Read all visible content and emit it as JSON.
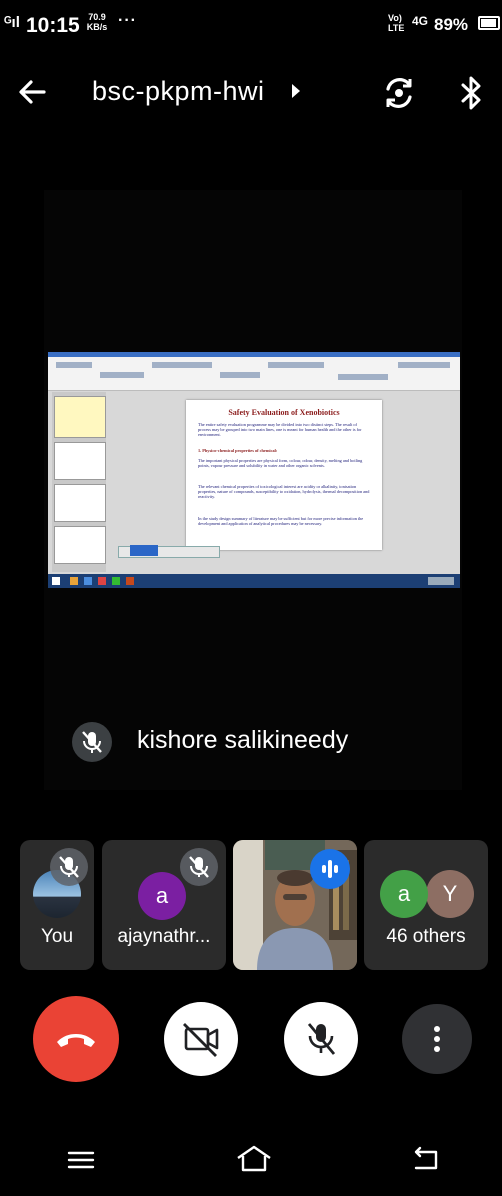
{
  "status_bar": {
    "signal": "ᴳıl",
    "time": "10:15",
    "speed_value": "70.9",
    "speed_unit": "KB/s",
    "overflow": "···",
    "network_top": "Vo)",
    "network_bottom": "LTE",
    "network_type": "4G",
    "battery": "89%"
  },
  "header": {
    "meeting_code": "bsc-pkpm-hwi"
  },
  "main_tile": {
    "presenter_name": "kishore salikineedy",
    "slide": {
      "title": "Safety Evaluation of Xenobiotics",
      "bullets": [
        "The entire safety evaluation programme may be divided into two distinct steps. The result of process may be grouped into two main lines, one is meant for human health and the other is for environment.",
        "1. Physico-chemical properties of chemical:",
        "The important physical properties are physical form, colour, odour, density, melting and boiling points, vapour pressure and solubility in water and other organic solvents.",
        "The relevant chemical properties of toxicological interest are acidity or alkalinity, ionisation properties, nature of compounds, susceptibility to oxidation, hydrolysis, thermal decomposition and reactivity.",
        "In the study design summary of literature may be sufficient but for more precise information the development and application of analytical procedures may be necessary."
      ]
    }
  },
  "participants": [
    {
      "label": "You",
      "muted": true
    },
    {
      "label": "ajaynathr...",
      "initial": "a",
      "avatar_color": "#7b1fa2",
      "muted": true
    },
    {
      "label": "",
      "speaking": true
    },
    {
      "label": "46 others",
      "initials": [
        "a",
        "Y"
      ],
      "avatar_colors": [
        "#43a047",
        "#8d6e63"
      ]
    }
  ],
  "controls": {
    "end_call_icon": "phone-hangup-icon",
    "camera_icon": "camera-off-icon",
    "mic_icon": "mic-off-icon",
    "more_icon": "more-vertical-icon"
  },
  "colors": {
    "end_call": "#ea4335",
    "speaking_indicator": "#1a73e8",
    "card_background": "#2b2b2b"
  }
}
